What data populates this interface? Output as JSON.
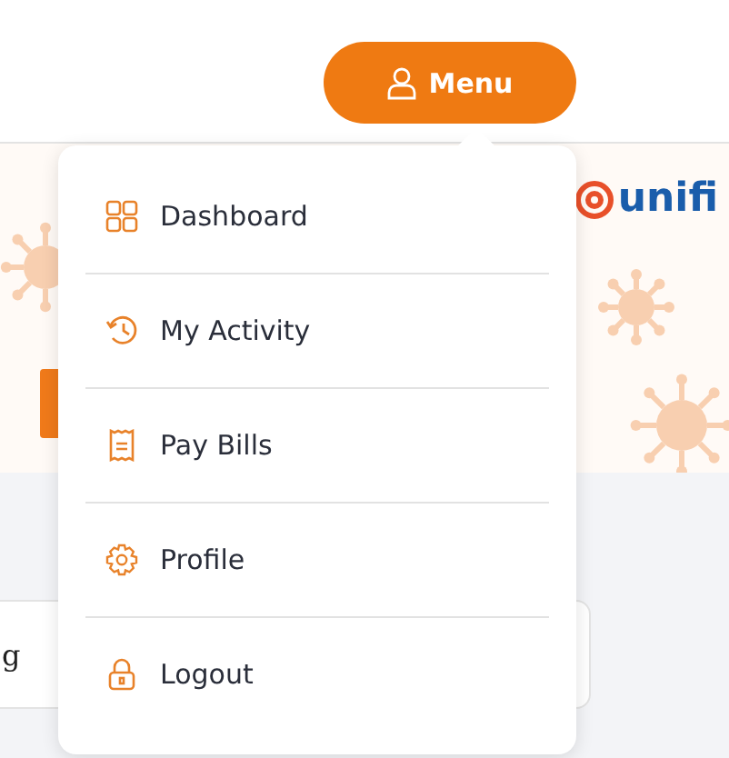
{
  "header": {
    "menu_button": "Menu"
  },
  "banner": {
    "kind": "picture",
    "logo": "unifi"
  },
  "card": {
    "text": "g"
  },
  "menu": {
    "items": [
      {
        "label": "Dashboard"
      },
      {
        "label": "My Activity"
      },
      {
        "label": "Pay Bills"
      },
      {
        "label": "Profile"
      },
      {
        "label": "Logout"
      }
    ]
  }
}
